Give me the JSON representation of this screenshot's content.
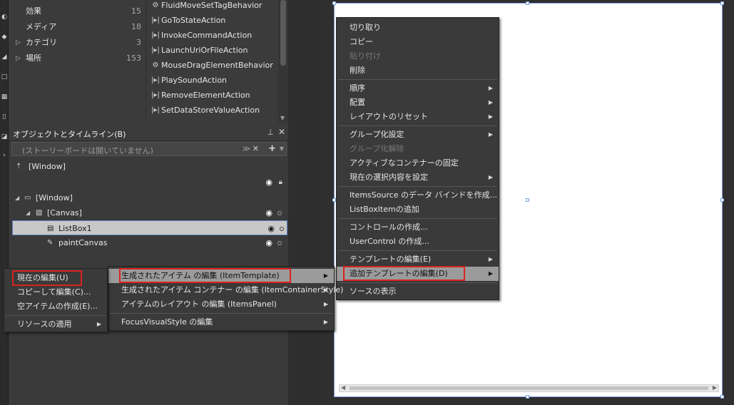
{
  "assets": {
    "categories": [
      {
        "label": "効果",
        "count": "15",
        "arrow": ""
      },
      {
        "label": "メディア",
        "count": "18",
        "arrow": ""
      },
      {
        "label": "カテゴリ",
        "count": "3",
        "arrow": "▷"
      },
      {
        "label": "場所",
        "count": "153",
        "arrow": "▷"
      }
    ],
    "items": [
      {
        "icon": "⚙",
        "label": "FluidMoveSetTagBehavior"
      },
      {
        "icon": "|▸|",
        "label": "GoToStateAction"
      },
      {
        "icon": "|▸|",
        "label": "InvokeCommandAction"
      },
      {
        "icon": "|▸|",
        "label": "LaunchUriOrFileAction"
      },
      {
        "icon": "⚙",
        "label": "MouseDragElementBehavior"
      },
      {
        "icon": "|▸|",
        "label": "PlaySoundAction"
      },
      {
        "icon": "|▸|",
        "label": "RemoveElementAction"
      },
      {
        "icon": "|▸|",
        "label": "SetDataStoreValueAction"
      }
    ]
  },
  "objects": {
    "title": "オブジェクトとタイムライン(B)",
    "storyboard_text": "(ストーリーボードは開いていません)",
    "scope_label": "[Window]",
    "tree": {
      "window": "[Window]",
      "canvas": "[Canvas]",
      "listbox": "ListBox1",
      "paint": "paintCanvas"
    }
  },
  "menu_edit": [
    {
      "label": "現在の編集(U)"
    },
    {
      "label": "コピーして編集(C)..."
    },
    {
      "label": "空アイテムの作成(E)..."
    },
    {
      "label": "リソースの適用"
    }
  ],
  "menu_templates": [
    {
      "label": "生成されたアイテム の編集 (ItemTemplate)"
    },
    {
      "label": "生成されたアイテム コンテナー の編集 (ItemContainerStyle)"
    },
    {
      "label": "アイテムのレイアウト の編集 (ItemsPanel)"
    },
    {
      "label": "FocusVisualStyle の編集"
    }
  ],
  "menu_context": [
    {
      "label": "切り取り"
    },
    {
      "label": "コピー"
    },
    {
      "label": "貼り付け"
    },
    {
      "label": "削除"
    },
    {
      "label": "順序"
    },
    {
      "label": "配置"
    },
    {
      "label": "レイアウトのリセット"
    },
    {
      "label": "グループ化設定"
    },
    {
      "label": "グループ化解除"
    },
    {
      "label": "アクティブなコンテナーの固定"
    },
    {
      "label": "現在の選択内容を設定"
    },
    {
      "label": "ItemsSource のデータ バインドを作成..."
    },
    {
      "label": "ListBoxItemの追加"
    },
    {
      "label": "コントロールの作成..."
    },
    {
      "label": "UserControl の作成..."
    },
    {
      "label": "テンプレートの編集(E)"
    },
    {
      "label": "追加テンプレートの編集(D)"
    },
    {
      "label": "ソースの表示"
    }
  ],
  "colors": {
    "panel_bg": "#3b3b3b",
    "menu_highlight": "#9b9b9b",
    "selection_bg": "#c8c8c8",
    "selection_border": "#5c7fc0",
    "annotation_red": "#d9231f",
    "artboard_border": "#7b9fd8"
  }
}
